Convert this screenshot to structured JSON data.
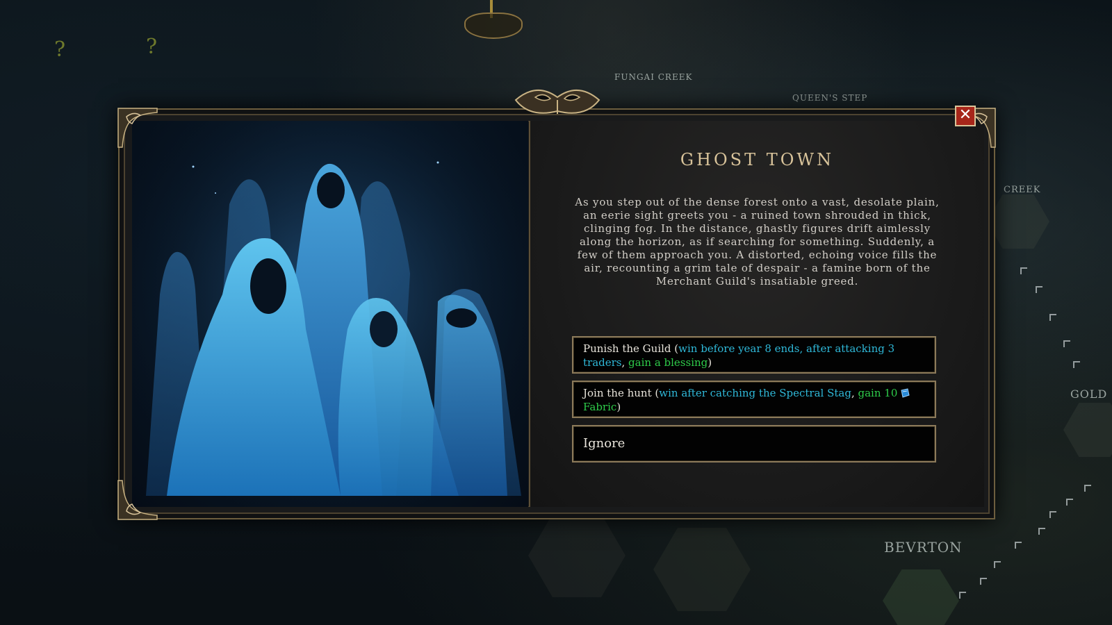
{
  "map": {
    "labels": {
      "fungai_creek": "FUNGAI CREEK",
      "queens_step": "QUEEN'S STEP",
      "creek": "CREEK",
      "gold": "GOLD",
      "bevrton": "BEVRTON"
    },
    "unknown_markers": [
      "?",
      "?"
    ]
  },
  "event": {
    "title": "GHOST TOWN",
    "description": "As you step out of the dense forest onto a vast, desolate plain, an eerie sight greets you - a ruined town shrouded in thick, clinging fog. In the distance, ghastly figures drift aimlessly along the horizon, as if searching for something. Suddenly, a few of them approach you. A distorted, echoing voice fills the air, recounting a grim tale of despair - a famine born of the Merchant Guild's insatiable greed.",
    "close_icon": "close-icon",
    "choices": [
      {
        "label": "Punish the Guild",
        "open_paren": " (",
        "condition": "win before year 8 ends, after attacking 3 traders",
        "separator": ", ",
        "reward": "gain a blessing",
        "close_paren": ")"
      },
      {
        "label": "Join the hunt",
        "open_paren": " (",
        "condition": "win after catching the Spectral Stag",
        "separator": ", ",
        "reward": "gain 10",
        "reward_icon": "fabric-icon",
        "reward_suffix": "Fabric",
        "close_paren": ")"
      },
      {
        "label": "Ignore"
      }
    ]
  },
  "colors": {
    "condition_text": "#2fb8d8",
    "reward_text": "#2ecc4a",
    "title_text": "#d8c39a",
    "close_button": "#a7261a"
  }
}
